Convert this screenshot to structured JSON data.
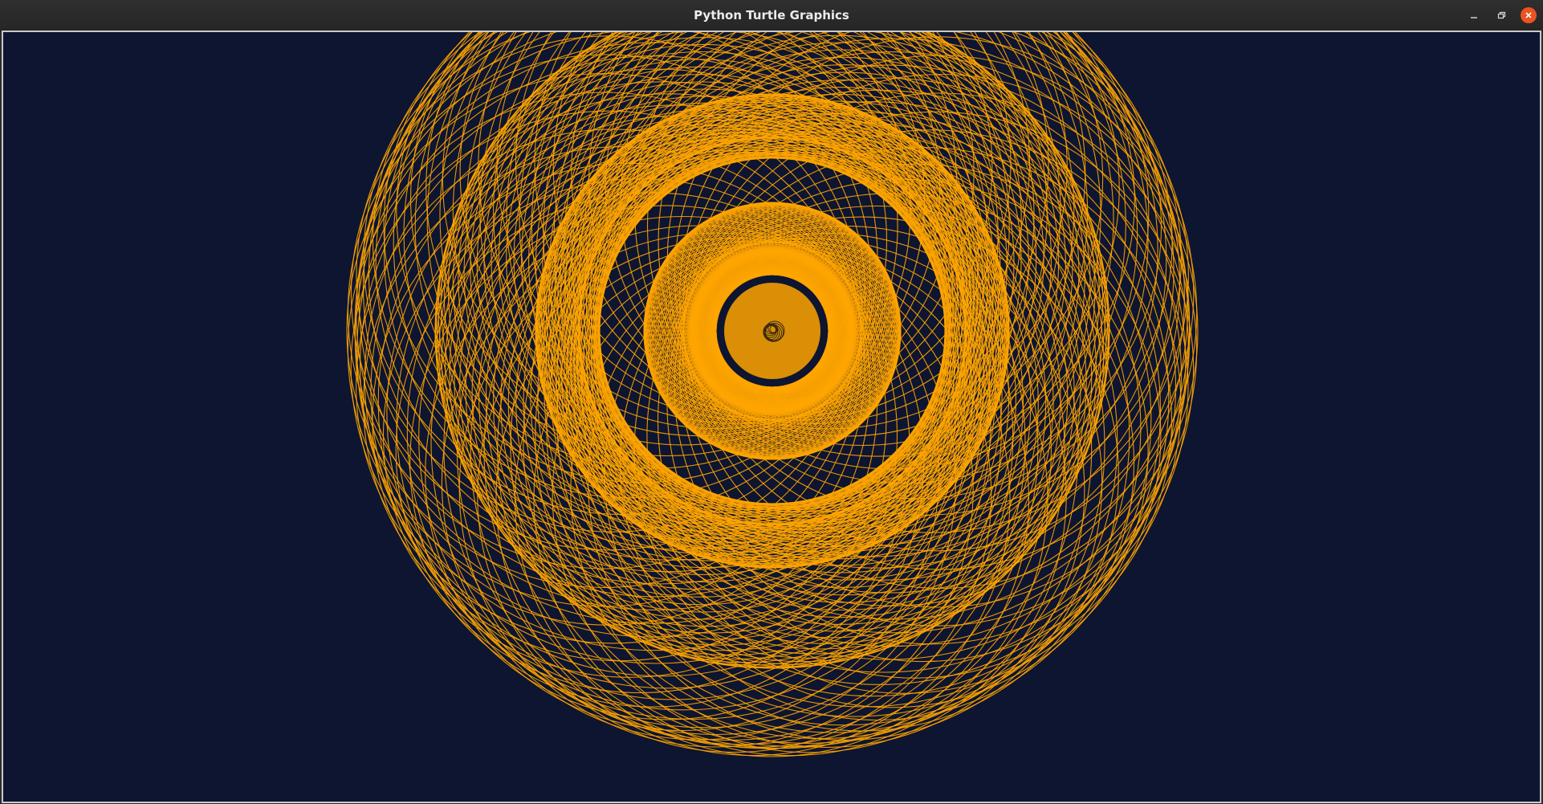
{
  "window": {
    "title": "Python Turtle Graphics",
    "controls": {
      "minimize_icon": "minimize-icon",
      "maximize_icon": "restore-icon",
      "close_icon": "close-icon"
    }
  },
  "canvas": {
    "background_color": "#0e1530",
    "pen_color": "#ffa500",
    "pattern": "spirograph circles"
  }
}
